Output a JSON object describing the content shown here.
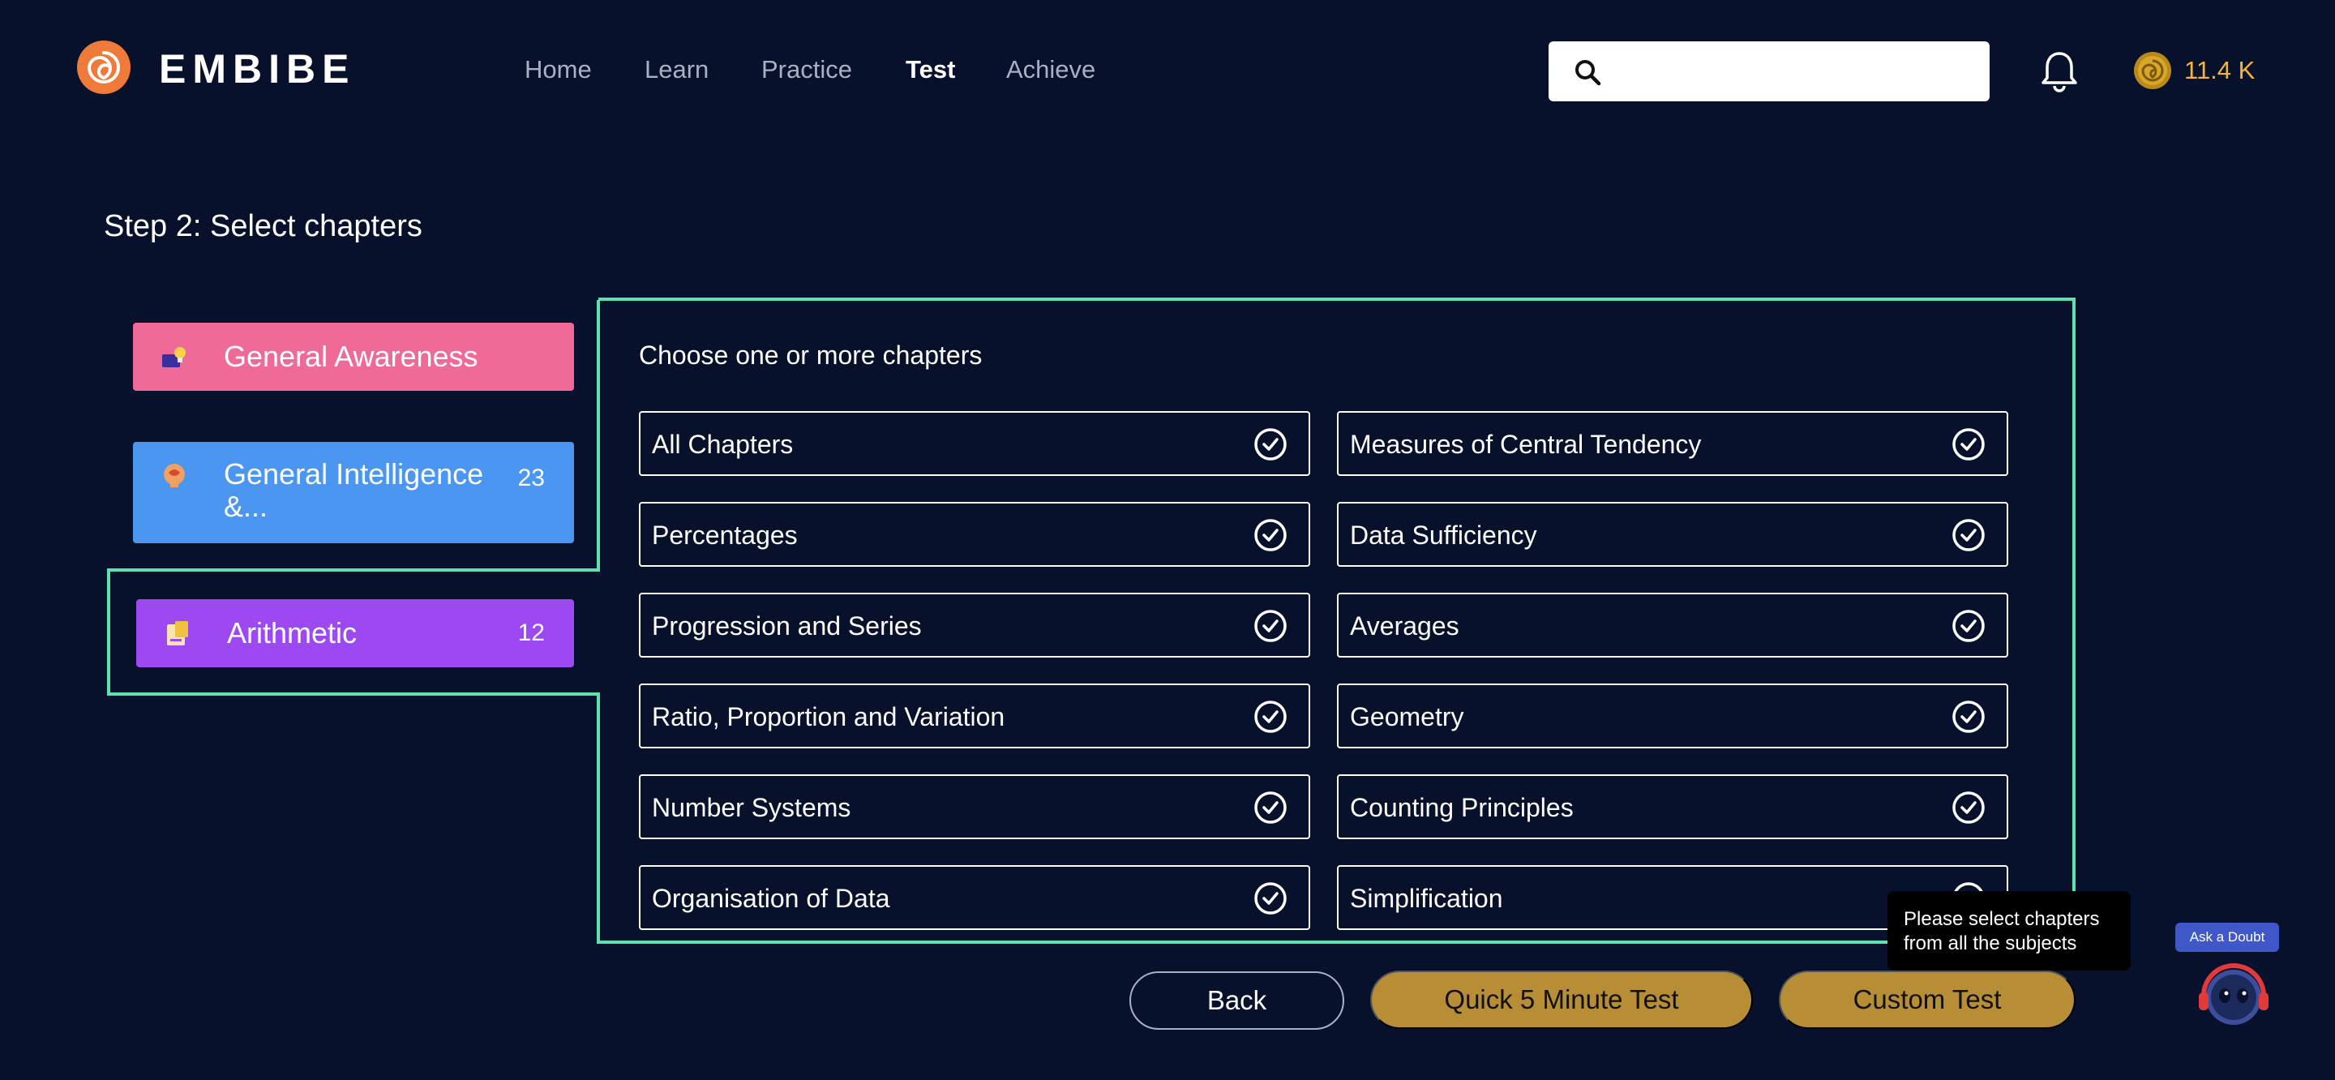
{
  "header": {
    "logo_text": "EMBIBE",
    "nav": [
      {
        "label": "Home",
        "active": false
      },
      {
        "label": "Learn",
        "active": false
      },
      {
        "label": "Practice",
        "active": false
      },
      {
        "label": "Test",
        "active": true
      },
      {
        "label": "Achieve",
        "active": false
      }
    ],
    "search": {
      "value": "",
      "placeholder": ""
    },
    "coins": "11.4 K"
  },
  "step_title": "Step 2: Select chapters",
  "subjects": [
    {
      "label": "General Awareness",
      "count": "",
      "color": "#ef6a96"
    },
    {
      "label": "General Intelligence &...",
      "count": "23",
      "color": "#4a96f0"
    },
    {
      "label": "Arithmetic",
      "count": "12",
      "color": "#9c49f1",
      "selected": true
    }
  ],
  "panel": {
    "title": "Choose one or more chapters",
    "chapters": [
      {
        "label": "All Chapters",
        "checked": true
      },
      {
        "label": "Measures of Central Tendency",
        "checked": true
      },
      {
        "label": "Percentages",
        "checked": true
      },
      {
        "label": "Data Sufficiency",
        "checked": true
      },
      {
        "label": "Progression and Series",
        "checked": true
      },
      {
        "label": "Averages",
        "checked": true
      },
      {
        "label": "Ratio, Proportion and Variation",
        "checked": true
      },
      {
        "label": "Geometry",
        "checked": true
      },
      {
        "label": "Number Systems",
        "checked": true
      },
      {
        "label": "Counting Principles",
        "checked": true
      },
      {
        "label": "Organisation of Data",
        "checked": true
      },
      {
        "label": "Simplification",
        "checked": true
      }
    ]
  },
  "actions": {
    "back": "Back",
    "quick_test": "Quick 5 Minute Test",
    "custom_test": "Custom Test"
  },
  "tooltip": "Please select chapters from all the subjects",
  "ask_doubt": "Ask a Doubt",
  "colors": {
    "background": "#08112b",
    "accent_outline": "#5ee0b0",
    "coin": "#f2b43c",
    "button_gold": "#b78d35"
  }
}
